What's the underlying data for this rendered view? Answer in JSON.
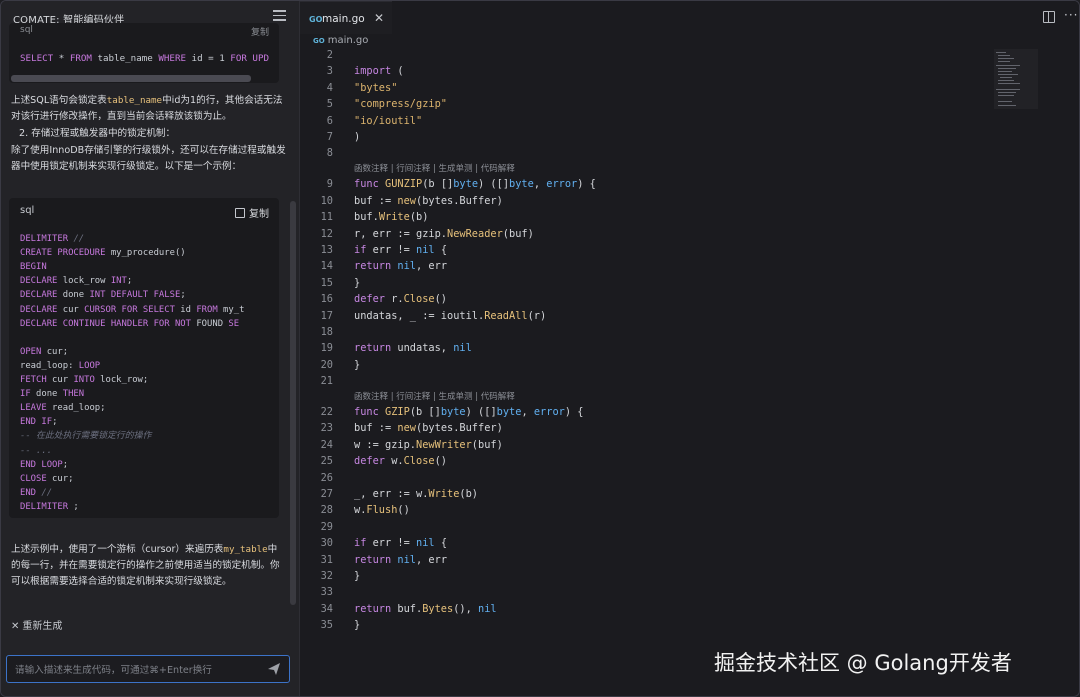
{
  "sidebar": {
    "title": "COMATE: 智能编码伙伴",
    "menu_icon": "menu-icon",
    "code_block_1": {
      "lang": "sql",
      "copy_label": "复制",
      "line": [
        {
          "t": "SELECT",
          "c": "kw"
        },
        {
          "t": " * ",
          "c": "tx"
        },
        {
          "t": "FROM",
          "c": "kw"
        },
        {
          "t": " table_name ",
          "c": "tx"
        },
        {
          "t": "WHERE",
          "c": "kw"
        },
        {
          "t": " id = 1 ",
          "c": "tx"
        },
        {
          "t": "FOR UPD",
          "c": "kw"
        }
      ]
    },
    "paragraph_1a": "上述SQL语句会锁定表",
    "paragraph_1_code": "table_name",
    "paragraph_1b": "中id为1的行，其他会话无法对该行进行修改操作，直到当前会话释放该锁为止。",
    "list_item_2": "2. 存储过程或触发器中的锁定机制：",
    "paragraph_2": "除了使用InnoDB存储引擎的行级锁外，还可以在存储过程或触发器中使用锁定机制来实现行级锁定。以下是一个示例：",
    "code_block_2": {
      "lang": "sql",
      "copy_label": "复制",
      "lines": [
        [
          {
            "t": "DELIMITER ",
            "c": "kw"
          },
          {
            "t": "//",
            "c": "cm"
          }
        ],
        [
          {
            "t": "CREATE PROCEDURE",
            "c": "kw"
          },
          {
            "t": " my_procedure()",
            "c": "fn"
          }
        ],
        [
          {
            "t": "BEGIN",
            "c": "kw"
          }
        ],
        [
          {
            "t": "    DECLARE",
            "c": "kw"
          },
          {
            "t": " lock_row ",
            "c": "tx"
          },
          {
            "t": "INT",
            "c": "kw"
          },
          {
            "t": ";",
            "c": "tx"
          }
        ],
        [
          {
            "t": "    DECLARE",
            "c": "kw"
          },
          {
            "t": " done ",
            "c": "tx"
          },
          {
            "t": "INT DEFAULT FALSE",
            "c": "kw"
          },
          {
            "t": ";",
            "c": "tx"
          }
        ],
        [
          {
            "t": "    DECLARE",
            "c": "kw"
          },
          {
            "t": " cur ",
            "c": "tx"
          },
          {
            "t": "CURSOR FOR SELECT",
            "c": "kw"
          },
          {
            "t": " id ",
            "c": "tx"
          },
          {
            "t": "FROM",
            "c": "kw"
          },
          {
            "t": " my_t",
            "c": "tx"
          }
        ],
        [
          {
            "t": "    DECLARE CONTINUE HANDLER FOR NOT",
            "c": "kw"
          },
          {
            "t": " FOUND ",
            "c": "tx"
          },
          {
            "t": "SE",
            "c": "kw"
          }
        ],
        [],
        [
          {
            "t": "    OPEN",
            "c": "kw"
          },
          {
            "t": " cur;",
            "c": "tx"
          }
        ],
        [
          {
            "t": "    read_loop: ",
            "c": "tx"
          },
          {
            "t": "LOOP",
            "c": "kw"
          }
        ],
        [
          {
            "t": "        FETCH",
            "c": "kw"
          },
          {
            "t": " cur ",
            "c": "tx"
          },
          {
            "t": "INTO",
            "c": "kw"
          },
          {
            "t": " lock_row;",
            "c": "tx"
          }
        ],
        [
          {
            "t": "        IF",
            "c": "kw"
          },
          {
            "t": " done ",
            "c": "tx"
          },
          {
            "t": "THEN",
            "c": "kw"
          }
        ],
        [
          {
            "t": "            LEAVE",
            "c": "kw"
          },
          {
            "t": " read_loop;",
            "c": "tx"
          }
        ],
        [
          {
            "t": "        END IF",
            "c": "kw"
          },
          {
            "t": ";",
            "c": "tx"
          }
        ],
        [
          {
            "t": "        -- 在此处执行需要锁定行的操作",
            "c": "cm"
          }
        ],
        [
          {
            "t": "        -- ...",
            "c": "cm"
          }
        ],
        [
          {
            "t": "    END LOOP",
            "c": "kw"
          },
          {
            "t": ";",
            "c": "tx"
          }
        ],
        [
          {
            "t": "    CLOSE",
            "c": "kw"
          },
          {
            "t": " cur;",
            "c": "tx"
          }
        ],
        [
          {
            "t": "END ",
            "c": "kw"
          },
          {
            "t": "//",
            "c": "cm"
          }
        ],
        [
          {
            "t": "DELIMITER",
            "c": "kw"
          },
          {
            "t": " ;",
            "c": "tx"
          }
        ]
      ]
    },
    "paragraph_3a": "上述示例中，使用了一个游标（cursor）来遍历表",
    "paragraph_3_code": "my_table",
    "paragraph_3b": "中的每一行，并在需要锁定行的操作之前使用适当的锁定机制。你可以根据需要选择合适的锁定机制来实现行级锁定。",
    "regenerate_label": "重新生成",
    "input_placeholder": "请输入描述来生成代码，可通过⌘+Enter换行"
  },
  "editor": {
    "tab_label": "main.go",
    "tab_icon": "go-file-icon",
    "breadcrumb": "main.go",
    "codelens": "函数注释 | 行间注释 | 生成单测 | 代码解释",
    "lines": [
      {
        "n": "2",
        "tokens": []
      },
      {
        "n": "3",
        "tokens": [
          {
            "t": "import",
            "c": "k"
          },
          {
            "t": " (",
            "c": ""
          }
        ]
      },
      {
        "n": "4",
        "tokens": [
          {
            "t": "    ",
            "c": ""
          },
          {
            "t": "\"bytes\"",
            "c": "s"
          }
        ]
      },
      {
        "n": "5",
        "tokens": [
          {
            "t": "    ",
            "c": ""
          },
          {
            "t": "\"compress/gzip\"",
            "c": "s"
          }
        ]
      },
      {
        "n": "6",
        "tokens": [
          {
            "t": "    ",
            "c": ""
          },
          {
            "t": "\"io/ioutil\"",
            "c": "s"
          }
        ]
      },
      {
        "n": "7",
        "tokens": [
          {
            "t": ")",
            "c": ""
          }
        ]
      },
      {
        "n": "8",
        "tokens": []
      },
      {
        "n": "9",
        "lens": true,
        "tokens": [
          {
            "t": "func",
            "c": "k"
          },
          {
            "t": " ",
            "c": ""
          },
          {
            "t": "GUNZIP",
            "c": "f"
          },
          {
            "t": "(b []",
            "c": ""
          },
          {
            "t": "byte",
            "c": "t"
          },
          {
            "t": ") ([]",
            "c": ""
          },
          {
            "t": "byte",
            "c": "t"
          },
          {
            "t": ", ",
            "c": ""
          },
          {
            "t": "error",
            "c": "t"
          },
          {
            "t": ") {",
            "c": ""
          }
        ]
      },
      {
        "n": "10",
        "tokens": [
          {
            "t": "    buf := ",
            "c": ""
          },
          {
            "t": "new",
            "c": "f"
          },
          {
            "t": "(bytes.Buffer)",
            "c": ""
          }
        ]
      },
      {
        "n": "11",
        "tokens": [
          {
            "t": "    buf.",
            "c": ""
          },
          {
            "t": "Write",
            "c": "f"
          },
          {
            "t": "(b)",
            "c": ""
          }
        ]
      },
      {
        "n": "12",
        "tokens": [
          {
            "t": "    r, err := gzip.",
            "c": ""
          },
          {
            "t": "NewReader",
            "c": "f"
          },
          {
            "t": "(buf)",
            "c": ""
          }
        ]
      },
      {
        "n": "13",
        "tokens": [
          {
            "t": "    ",
            "c": ""
          },
          {
            "t": "if",
            "c": "k"
          },
          {
            "t": " err != ",
            "c": ""
          },
          {
            "t": "nil",
            "c": "t"
          },
          {
            "t": " {",
            "c": ""
          }
        ]
      },
      {
        "n": "14",
        "tokens": [
          {
            "t": "        ",
            "c": ""
          },
          {
            "t": "return",
            "c": "k"
          },
          {
            "t": " ",
            "c": ""
          },
          {
            "t": "nil",
            "c": "t"
          },
          {
            "t": ", err",
            "c": ""
          }
        ]
      },
      {
        "n": "15",
        "tokens": [
          {
            "t": "    }",
            "c": ""
          }
        ]
      },
      {
        "n": "16",
        "tokens": [
          {
            "t": "    ",
            "c": ""
          },
          {
            "t": "defer",
            "c": "k"
          },
          {
            "t": " r.",
            "c": ""
          },
          {
            "t": "Close",
            "c": "f"
          },
          {
            "t": "()",
            "c": ""
          }
        ]
      },
      {
        "n": "17",
        "tokens": [
          {
            "t": "    undatas, _ := ioutil.",
            "c": ""
          },
          {
            "t": "ReadAll",
            "c": "f"
          },
          {
            "t": "(r)",
            "c": ""
          }
        ]
      },
      {
        "n": "18",
        "tokens": []
      },
      {
        "n": "19",
        "tokens": [
          {
            "t": "    ",
            "c": ""
          },
          {
            "t": "return",
            "c": "k"
          },
          {
            "t": " undatas, ",
            "c": ""
          },
          {
            "t": "nil",
            "c": "t"
          }
        ]
      },
      {
        "n": "20",
        "tokens": [
          {
            "t": "}",
            "c": ""
          }
        ]
      },
      {
        "n": "21",
        "tokens": []
      },
      {
        "n": "22",
        "lens": true,
        "tokens": [
          {
            "t": "func",
            "c": "k"
          },
          {
            "t": " ",
            "c": ""
          },
          {
            "t": "GZIP",
            "c": "f"
          },
          {
            "t": "(b []",
            "c": ""
          },
          {
            "t": "byte",
            "c": "t"
          },
          {
            "t": ") ([]",
            "c": ""
          },
          {
            "t": "byte",
            "c": "t"
          },
          {
            "t": ", ",
            "c": ""
          },
          {
            "t": "error",
            "c": "t"
          },
          {
            "t": ") {",
            "c": ""
          }
        ]
      },
      {
        "n": "23",
        "tokens": [
          {
            "t": "    buf := ",
            "c": ""
          },
          {
            "t": "new",
            "c": "f"
          },
          {
            "t": "(bytes.Buffer)",
            "c": ""
          }
        ]
      },
      {
        "n": "24",
        "tokens": [
          {
            "t": "    w := gzip.",
            "c": ""
          },
          {
            "t": "NewWriter",
            "c": "f"
          },
          {
            "t": "(buf)",
            "c": ""
          }
        ]
      },
      {
        "n": "25",
        "tokens": [
          {
            "t": "    ",
            "c": ""
          },
          {
            "t": "defer",
            "c": "k"
          },
          {
            "t": " w.",
            "c": ""
          },
          {
            "t": "Close",
            "c": "f"
          },
          {
            "t": "()",
            "c": ""
          }
        ]
      },
      {
        "n": "26",
        "tokens": []
      },
      {
        "n": "27",
        "tokens": [
          {
            "t": "    _, err := w.",
            "c": ""
          },
          {
            "t": "Write",
            "c": "f"
          },
          {
            "t": "(b)",
            "c": ""
          }
        ]
      },
      {
        "n": "28",
        "tokens": [
          {
            "t": "    w.",
            "c": ""
          },
          {
            "t": "Flush",
            "c": "f"
          },
          {
            "t": "()",
            "c": ""
          }
        ]
      },
      {
        "n": "29",
        "tokens": []
      },
      {
        "n": "30",
        "tokens": [
          {
            "t": "    ",
            "c": ""
          },
          {
            "t": "if",
            "c": "k"
          },
          {
            "t": " err != ",
            "c": ""
          },
          {
            "t": "nil",
            "c": "t"
          },
          {
            "t": " {",
            "c": ""
          }
        ]
      },
      {
        "n": "31",
        "tokens": [
          {
            "t": "        ",
            "c": ""
          },
          {
            "t": "return",
            "c": "k"
          },
          {
            "t": " ",
            "c": ""
          },
          {
            "t": "nil",
            "c": "t"
          },
          {
            "t": ", err",
            "c": ""
          }
        ]
      },
      {
        "n": "32",
        "tokens": [
          {
            "t": "    }",
            "c": ""
          }
        ]
      },
      {
        "n": "33",
        "tokens": []
      },
      {
        "n": "34",
        "tokens": [
          {
            "t": "    ",
            "c": ""
          },
          {
            "t": "return",
            "c": "k"
          },
          {
            "t": " buf.",
            "c": ""
          },
          {
            "t": "Bytes",
            "c": "f"
          },
          {
            "t": "(), ",
            "c": ""
          },
          {
            "t": "nil",
            "c": "t"
          }
        ]
      },
      {
        "n": "35",
        "tokens": [
          {
            "t": "}",
            "c": ""
          }
        ]
      }
    ]
  },
  "watermark": "掘金技术社区 @ Golang开发者",
  "colors": {
    "accent": "#3c73c9",
    "keyword": "#c586e0",
    "string": "#dcb46e",
    "type": "#61afef"
  }
}
